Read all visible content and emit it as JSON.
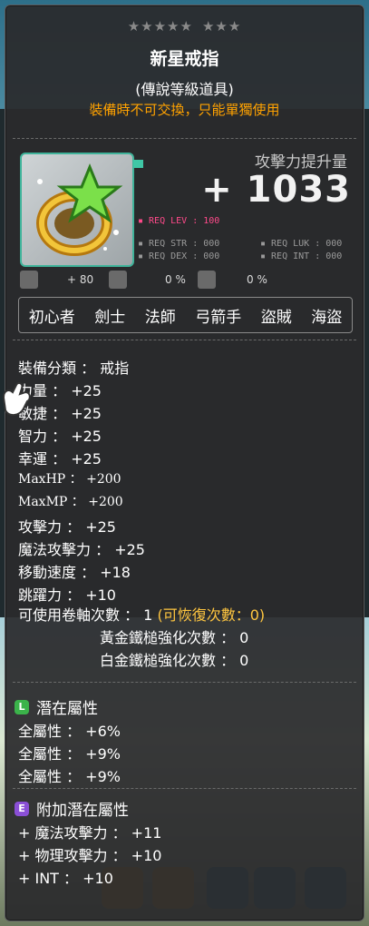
{
  "tooltip": {
    "stars_left": "★★★★★",
    "stars_right": "★★★",
    "title": "新星戒指",
    "rank": "(傳說等級道具)",
    "trade_note": "裝備時不可交換，只能單獨使用",
    "attack_label": "攻擊力提升量",
    "attack_value": "+ 1033",
    "req_lev": "▪ REQ LEV : 100",
    "req_str": "▪ REQ STR : 000",
    "req_luk": "▪ REQ LUK : 000",
    "req_dex": "▪ REQ DEX : 000",
    "req_int": "▪ REQ INT : 000",
    "icon_row": [
      "+ 80",
      "0 %",
      "0 %"
    ],
    "jobs": [
      "初心者",
      "劍士",
      "法師",
      "弓箭手",
      "盜賊",
      "海盜"
    ],
    "stats": [
      {
        "label": "裝備分類",
        "sep": " ： ",
        "value": "戒指"
      },
      {
        "label": "力量",
        "sep": " ： ",
        "value": "+25"
      },
      {
        "label": "敏捷",
        "sep": " ： ",
        "value": "+25"
      },
      {
        "label": "智力",
        "sep": " ： ",
        "value": "+25"
      },
      {
        "label": "幸運",
        "sep": " ： ",
        "value": "+25"
      },
      {
        "label": "MaxHP",
        "sep": " ： ",
        "value": "+200"
      },
      {
        "label": "MaxMP",
        "sep": " ： ",
        "value": "+200"
      },
      {
        "label": "攻擊力",
        "sep": " ： ",
        "value": "+25"
      },
      {
        "label": "魔法攻擊力",
        "sep": " ： ",
        "value": "+25"
      },
      {
        "label": "移動速度",
        "sep": " ： ",
        "value": "+18"
      },
      {
        "label": "跳躍力",
        "sep": " ： ",
        "value": "+10"
      }
    ],
    "scroll_count": "可使用卷軸次數 ： 1",
    "scroll_recover": "(可恢復次數：0)",
    "gold_hammer": "黃金鐵槌強化次數 ： 0",
    "plat_hammer": "白金鐵槌強化次數 ： 0",
    "potential_badge": "L",
    "potential_title": "潛在屬性",
    "potential": [
      "全屬性 ： +6%",
      "全屬性 ： +9%",
      "全屬性 ： +9%"
    ],
    "additional_badge": "E",
    "additional_title": "附加潛在屬性",
    "additional": [
      "+ 魔法攻擊力 ： +11",
      "+ 物理攻擊力 ： +10",
      "+ INT ： +10"
    ]
  },
  "colors": {
    "trade": "#ffa200",
    "req_lev": "#ff4a8a",
    "potential_badge": "#3bb34a",
    "additional_badge": "#8a4fd6",
    "scroll_note": "#ffc640"
  },
  "icons": [
    "ring-item-icon",
    "star-icon",
    "upgrade-icon",
    "scissors-icon",
    "shield-icon",
    "pointer-hand-icon"
  ]
}
